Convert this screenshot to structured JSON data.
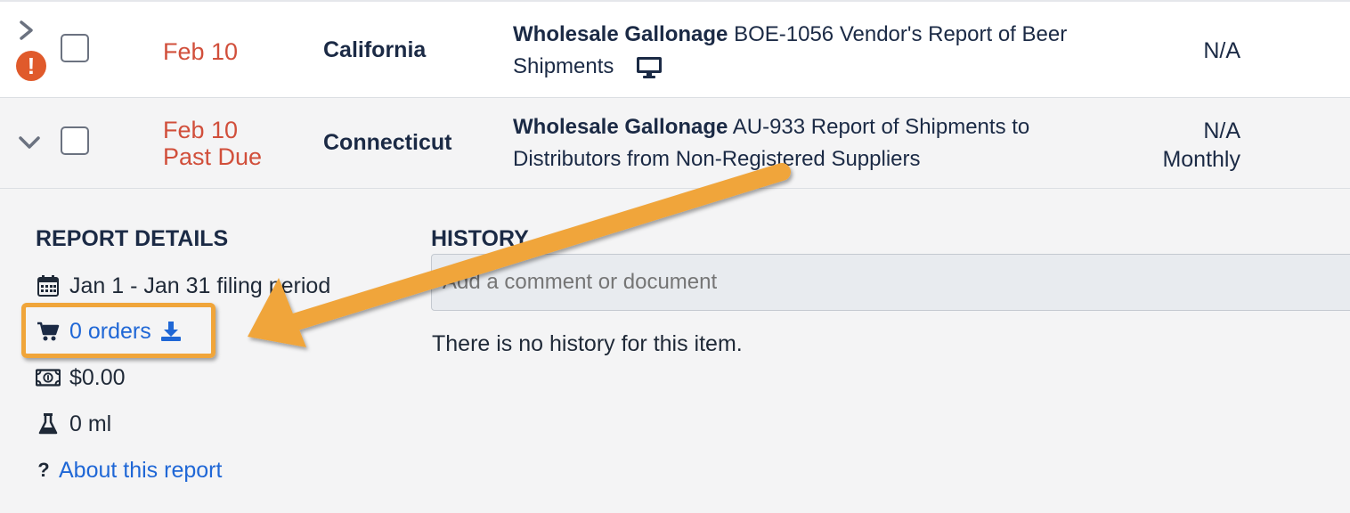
{
  "rows": [
    {
      "date": "Feb 10",
      "status": "",
      "state": "California",
      "type": "Wholesale Gallonage",
      "report": "BOE-1056 Vendor's Report of Beer Shipments",
      "value": "N/A",
      "frequency": "",
      "expanded": false,
      "has_alert": true,
      "icons": [
        "chevron-right-icon",
        "alert-icon",
        "monitor-icon"
      ]
    },
    {
      "date": "Feb 10",
      "status": "Past Due",
      "state": "Connecticut",
      "type": "Wholesale Gallonage",
      "report": "AU-933 Report of Shipments to Distributors from Non-Registered Suppliers",
      "value": "N/A",
      "frequency": "Monthly",
      "expanded": true,
      "icons": [
        "chevron-down-icon"
      ]
    }
  ],
  "details": {
    "title": "REPORT DETAILS",
    "filing_period": "Jan 1 - Jan 31 filing period",
    "orders": "0 orders",
    "amount": "$0.00",
    "volume": "0 ml",
    "about_link": "About this report",
    "icons": [
      "calendar-icon",
      "cart-icon",
      "download-icon",
      "money-icon",
      "flask-icon",
      "question-icon"
    ]
  },
  "history": {
    "title": "HISTORY",
    "comment_placeholder": "Add a comment or document",
    "empty_text": "There is no history for this item."
  },
  "colors": {
    "date_red": "#d14f3b",
    "link_blue": "#1f67d6",
    "alert_orange": "#e05a2b",
    "annotation_orange": "#f0a53a",
    "navy_text": "#1b2a45"
  }
}
